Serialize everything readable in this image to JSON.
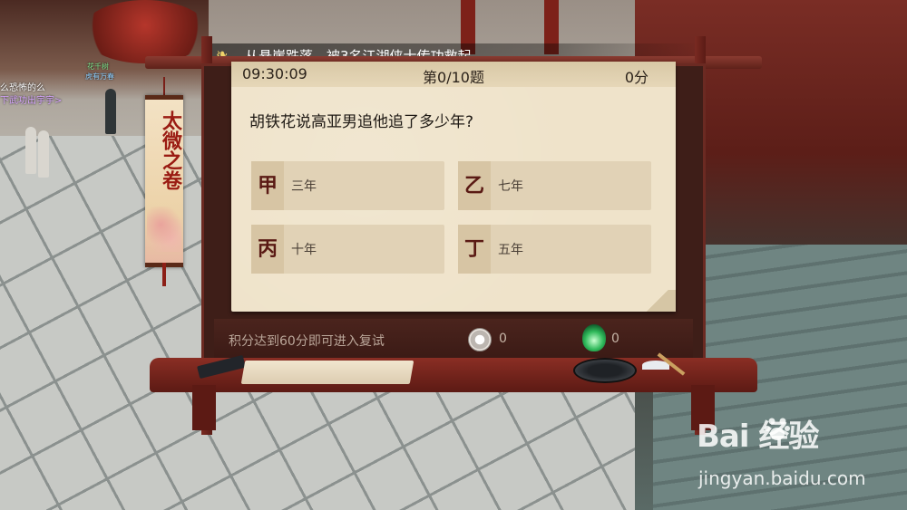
{
  "ticker": {
    "text": "从悬崖跌落，被3名江湖侠士传功救起。",
    "icon": "bamboo-scroll-icon"
  },
  "banner": {
    "title": "太微之卷"
  },
  "quiz": {
    "timer": "09:30:09",
    "question_number": "第0/10题",
    "score": "0分",
    "question": "胡铁花说高亚男追他追了多少年?",
    "options": [
      {
        "glyph": "甲",
        "text": "三年"
      },
      {
        "glyph": "乙",
        "text": "七年"
      },
      {
        "glyph": "丙",
        "text": "十年"
      },
      {
        "glyph": "丁",
        "text": "五年"
      }
    ]
  },
  "footer": {
    "hint": "积分达到60分即可进入复试",
    "coin_value": "0",
    "jade_value": "0"
  },
  "scene_labels": {
    "npc_a_name": "么恐怖的么",
    "npc_a_sub": "下武功出宇宇>",
    "npc_b_name": "花千树",
    "npc_b_title": "虎有万春"
  },
  "watermark": {
    "logo": "Bai 经验",
    "url": "jingyan.baidu.com"
  }
}
